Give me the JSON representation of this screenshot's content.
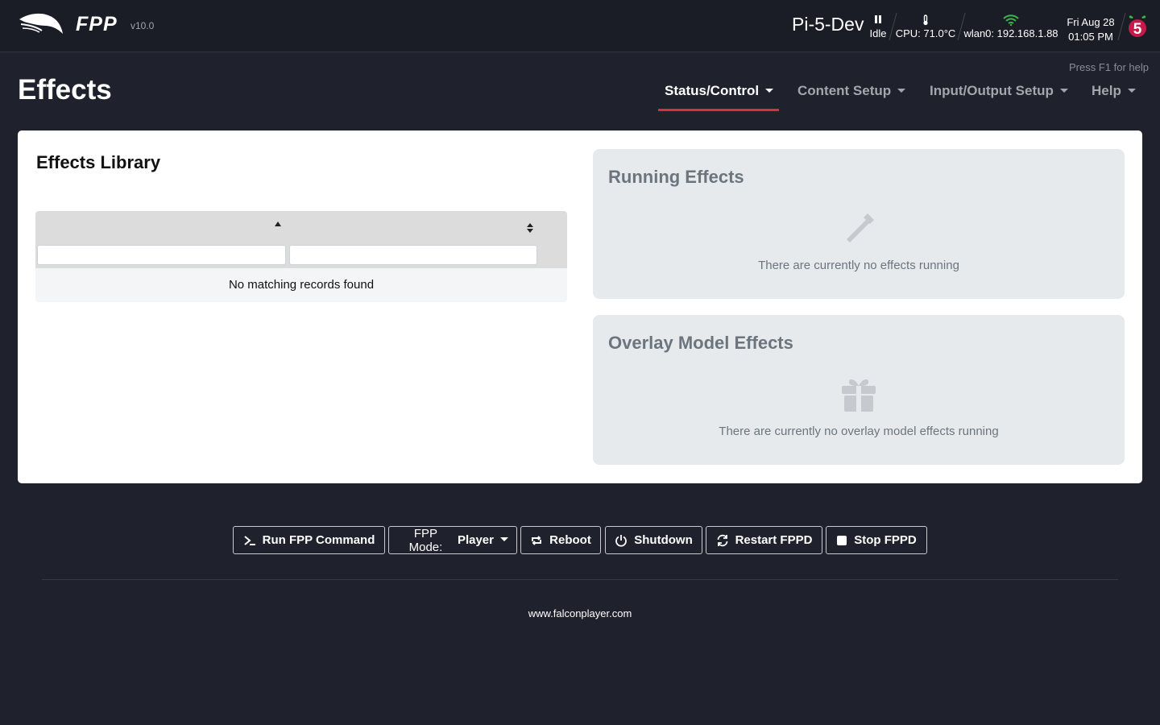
{
  "header": {
    "brand": "FPP",
    "version": "v10.0",
    "hostname": "Pi-5-Dev",
    "status": "Idle",
    "cpu": "CPU: 71.0°C",
    "network": "wlan0: 192.168.1.88",
    "date": "Fri Aug 28",
    "time": "01:05 PM",
    "icons": [
      "falcon-logo",
      "pause-icon",
      "thermometer-icon",
      "wifi-icon",
      "raspberry-pi-5-icon"
    ],
    "wifi_color": "#3bb54a"
  },
  "help_hint": "Press F1 for help",
  "page_title": "Effects",
  "nav": [
    {
      "label": "Status/Control",
      "active": true
    },
    {
      "label": "Content Setup",
      "active": false
    },
    {
      "label": "Input/Output Setup",
      "active": false
    },
    {
      "label": "Help",
      "active": false
    }
  ],
  "library": {
    "title": "Effects Library",
    "empty_message": "No matching records found"
  },
  "running": {
    "title": "Running Effects",
    "message": "There are currently no effects running",
    "icon": "magic-wand-icon"
  },
  "overlay": {
    "title": "Overlay Model Effects",
    "message": "There are currently no overlay model effects running",
    "icon": "gift-icon"
  },
  "buttons": {
    "run_command": "Run FPP Command",
    "mode_label": "FPP Mode:",
    "mode_value": "Player",
    "reboot": "Reboot",
    "shutdown": "Shutdown",
    "restart": "Restart FPPD",
    "stop": "Stop FPPD"
  },
  "footer": {
    "link": "www.falconplayer.com"
  },
  "colors": {
    "background": "#1f212c",
    "accent": "#d9303a",
    "panel": "#e7eaed"
  }
}
